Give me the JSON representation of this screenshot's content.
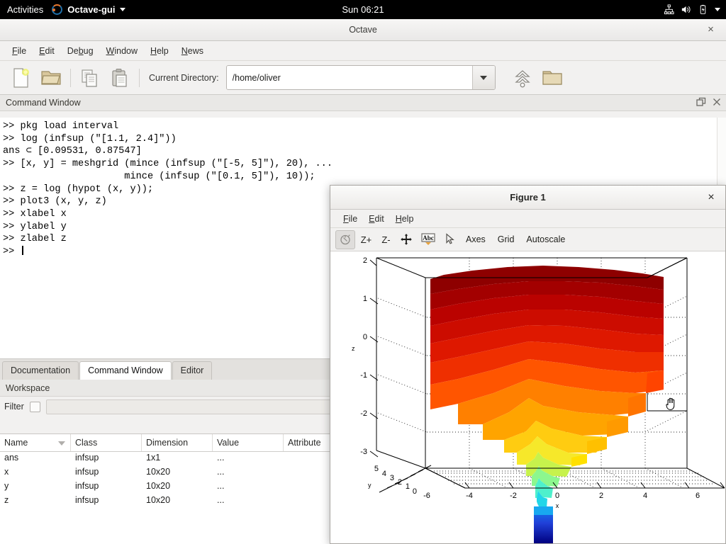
{
  "desktop": {
    "activities_label": "Activities",
    "app_name": "Octave-gui",
    "app_icon": "octave-logo-icon",
    "clock": "Sun 06:21",
    "tray": [
      "network-icon",
      "volume-icon",
      "battery-icon",
      "chevron-down-icon"
    ]
  },
  "main_window": {
    "title": "Octave",
    "close_label": "×",
    "menus": [
      {
        "label": "File",
        "mnemonic": "F"
      },
      {
        "label": "Edit",
        "mnemonic": "E"
      },
      {
        "label": "Debug",
        "mnemonic": "b"
      },
      {
        "label": "Window",
        "mnemonic": "W"
      },
      {
        "label": "Help",
        "mnemonic": "H"
      },
      {
        "label": "News",
        "mnemonic": "N"
      }
    ],
    "toolbar": {
      "new_script_icon": "new-script-icon",
      "open_file_icon": "open-folder-icon",
      "copy_icon": "copy-icon",
      "paste_icon": "paste-icon",
      "cwd_label": "Current Directory:",
      "cwd_value": "/home/oliver",
      "cwd_placeholder": "",
      "up_dir_icon": "up-directory-icon",
      "browse_icon": "browse-folder-icon"
    }
  },
  "command_window": {
    "dock_title": "Command Window",
    "undock_icon": "undock-icon",
    "close_icon": "close-icon",
    "lines": [
      ">> pkg load interval",
      ">> log (infsup (\"[1.1, 2.4]\"))",
      "ans ⊂ [0.09531, 0.87547]",
      ">> [x, y] = meshgrid (mince (infsup (\"[-5, 5]\"), 20), ...",
      "                     mince (infsup (\"[0.1, 5]\"), 10));",
      ">> z = log (hypot (x, y));",
      ">> plot3 (x, y, z)",
      ">> xlabel x",
      ">> ylabel y",
      ">> zlabel z",
      ">> "
    ]
  },
  "bottom_tabs": [
    {
      "label": "Documentation",
      "active": false
    },
    {
      "label": "Command Window",
      "active": true
    },
    {
      "label": "Editor",
      "active": false
    }
  ],
  "workspace": {
    "title": "Workspace",
    "filter_label": "Filter",
    "filter_value": "",
    "filter_placeholder": "",
    "columns": [
      "Name",
      "Class",
      "Dimension",
      "Value",
      "Attribute"
    ],
    "sort_column": "Name",
    "rows": [
      {
        "name": "ans",
        "class": "infsup",
        "dimension": "1x1",
        "value": "...",
        "attribute": ""
      },
      {
        "name": "x",
        "class": "infsup",
        "dimension": "10x20",
        "value": "...",
        "attribute": ""
      },
      {
        "name": "y",
        "class": "infsup",
        "dimension": "10x20",
        "value": "...",
        "attribute": ""
      },
      {
        "name": "z",
        "class": "infsup",
        "dimension": "10x20",
        "value": "...",
        "attribute": ""
      }
    ]
  },
  "figure_window": {
    "title": "Figure 1",
    "close_label": "×",
    "menus": [
      {
        "label": "File",
        "mnemonic": "F"
      },
      {
        "label": "Edit",
        "mnemonic": "E"
      },
      {
        "label": "Help",
        "mnemonic": "H"
      }
    ],
    "toolbar": {
      "rotate_label": "rotate-icon",
      "zoom_in_label": "Z+",
      "zoom_out_label": "Z-",
      "pan_label": "pan-icon",
      "text_label": "Abc",
      "select_label": "cursor-icon",
      "axes_label": "Axes",
      "grid_label": "Grid",
      "autoscale_label": "Autoscale"
    },
    "cursor": "open-hand-cursor"
  },
  "chart_data": {
    "type": "line",
    "title": "",
    "xlabel": "x",
    "ylabel": "y",
    "zlabel": "z",
    "projection": "3d",
    "grid": true,
    "legend": null,
    "xlim": [
      -6,
      6
    ],
    "ylim": [
      0,
      5
    ],
    "zlim": [
      -3,
      2
    ],
    "xticks": [
      -6,
      -4,
      -2,
      0,
      2,
      4,
      6
    ],
    "yticks": [
      0,
      1,
      2,
      3,
      4,
      5
    ],
    "zticks": [
      -3,
      -2,
      -1,
      0,
      1,
      2
    ],
    "colormap": "jet",
    "description": "plot3 of z = log(hypot(x,y)) over interval meshgrid x in [-5,5] (20 bins), y in [0.1,5] (10 bins)",
    "surface_min_z": -3,
    "surface_max_z": 1.95
  }
}
